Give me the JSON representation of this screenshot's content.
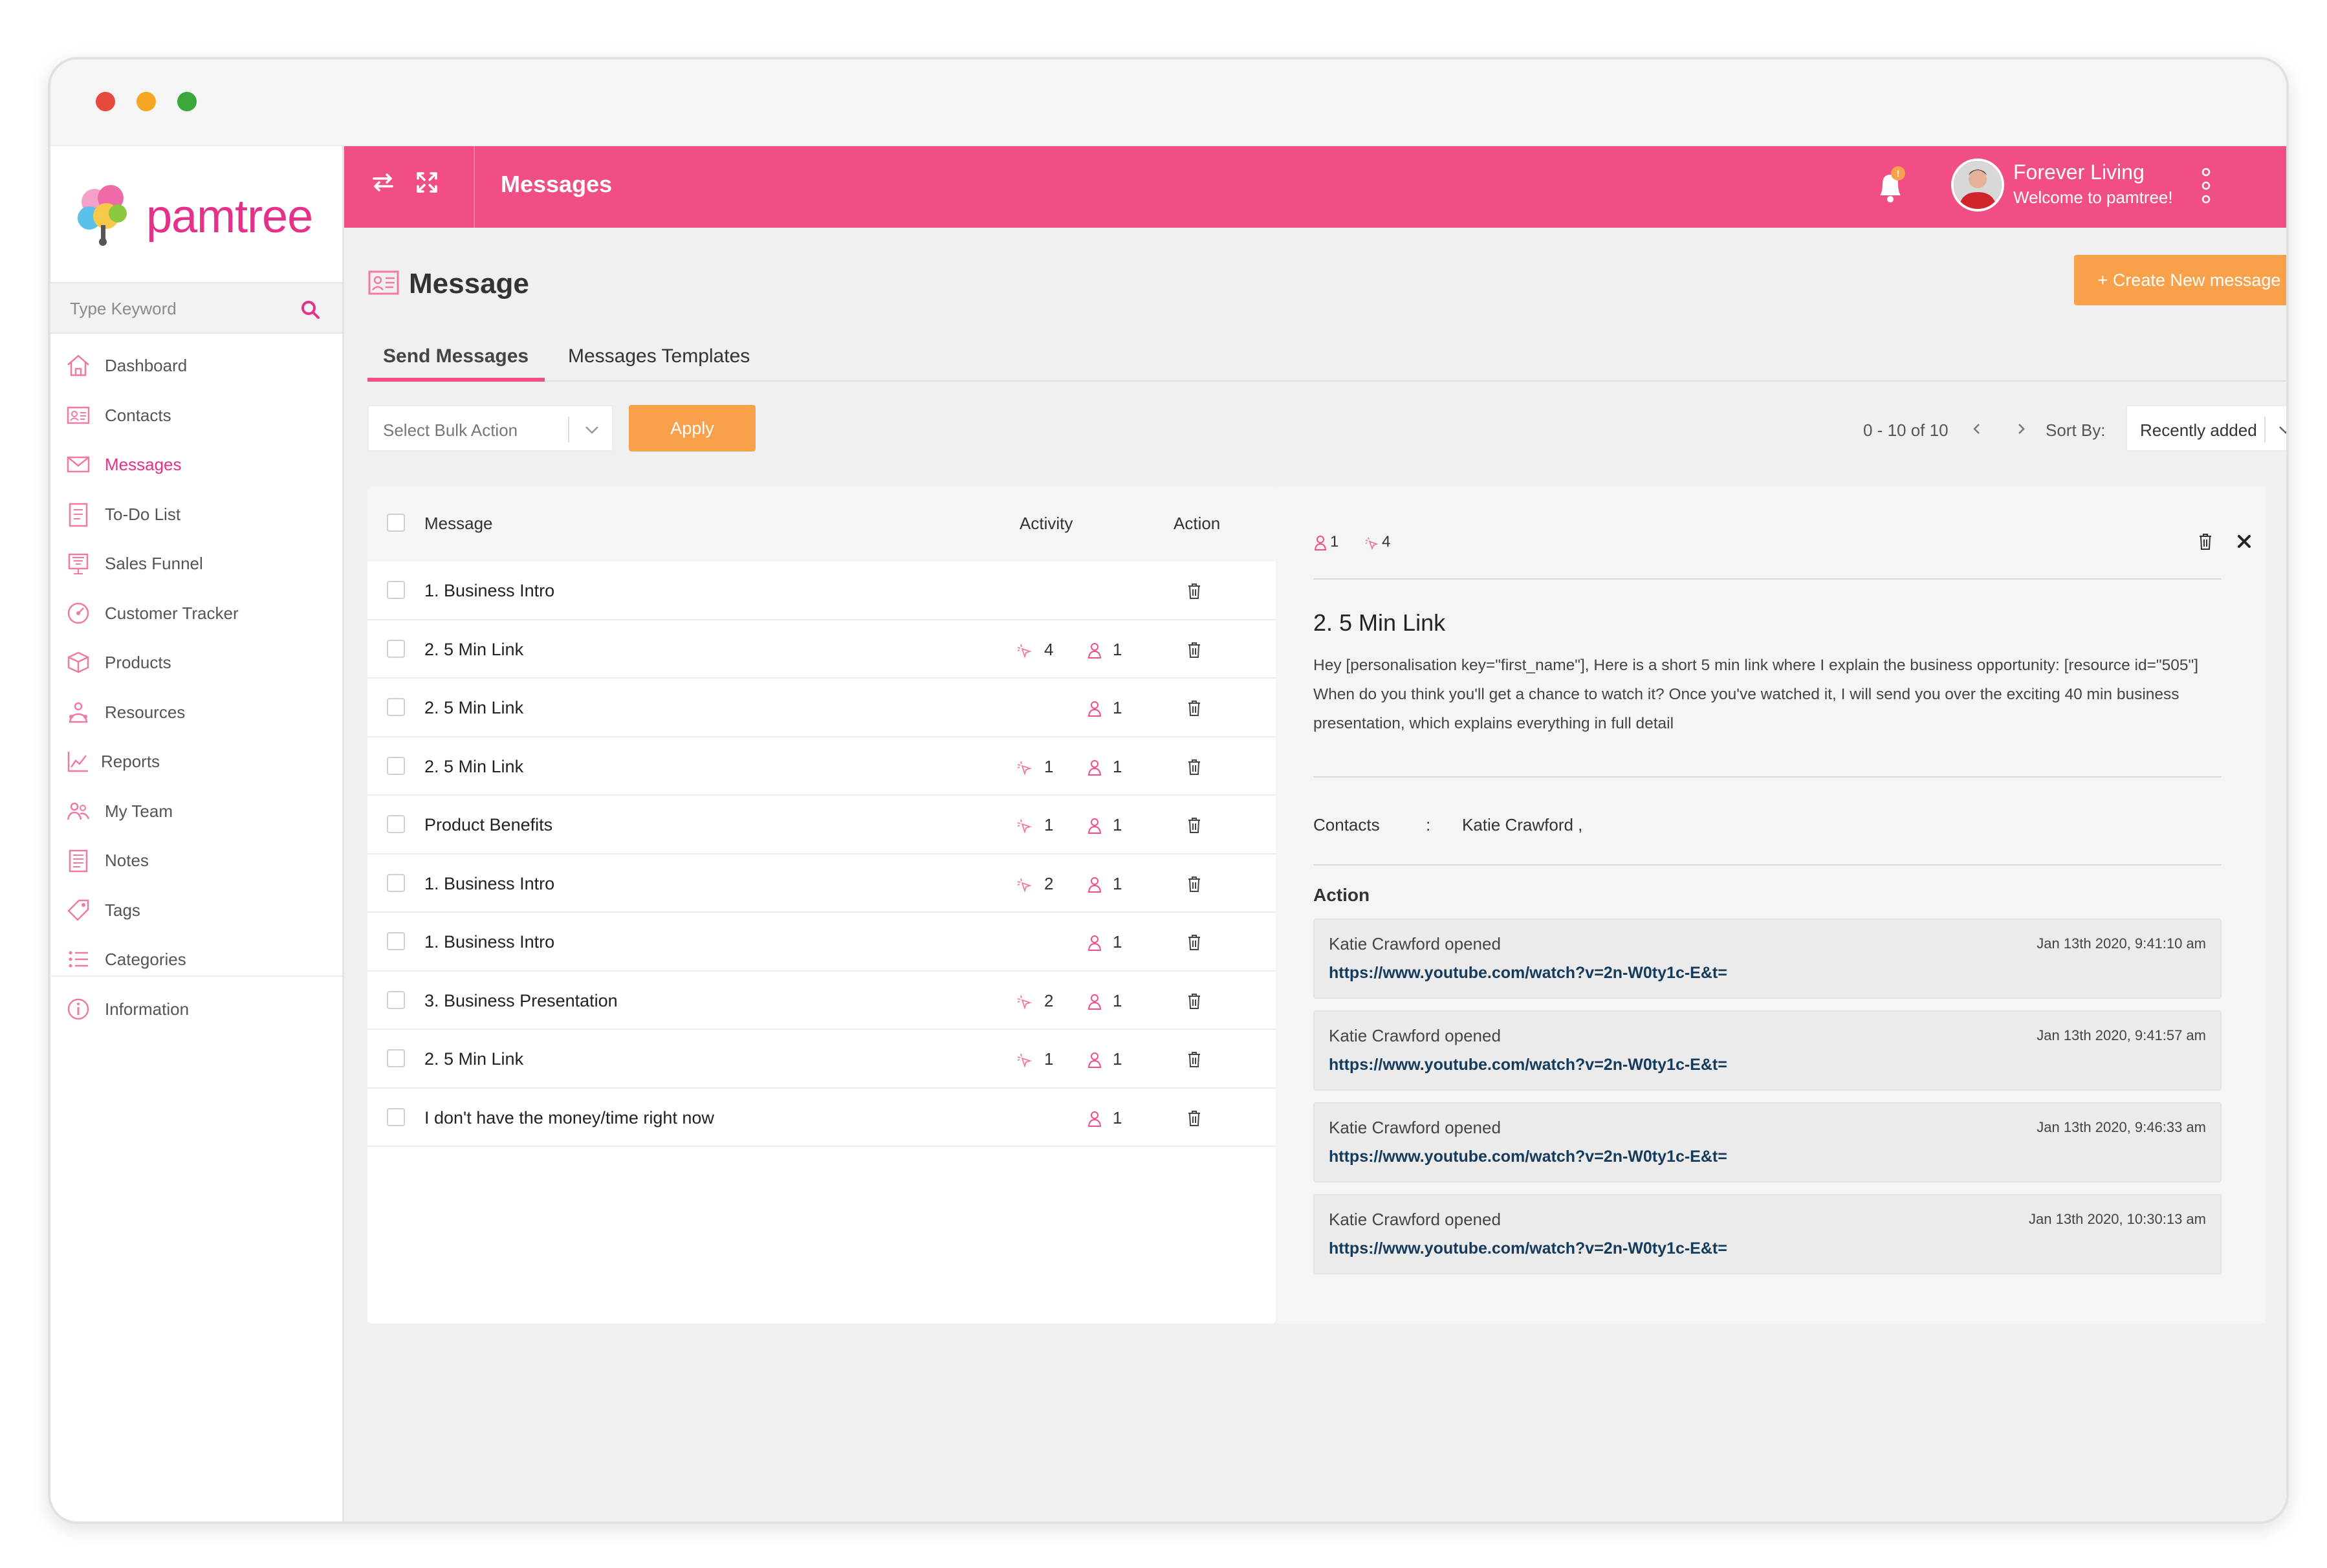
{
  "app": {
    "logo_text": "pamtree",
    "accent_color": "#f04e85",
    "orange_color": "#f9a04a"
  },
  "sidebar": {
    "search_placeholder": "Type Keyword",
    "items": [
      {
        "label": "Dashboard",
        "icon": "home-icon"
      },
      {
        "label": "Contacts",
        "icon": "contacts-card-icon"
      },
      {
        "label": "Messages",
        "icon": "envelope-icon",
        "active": true
      },
      {
        "label": "To-Do List",
        "icon": "clipboard-list-icon"
      },
      {
        "label": "Sales Funnel",
        "icon": "funnel-chart-icon"
      },
      {
        "label": "Customer Tracker",
        "icon": "tracker-gauge-icon"
      },
      {
        "label": "Products",
        "icon": "package-box-icon"
      },
      {
        "label": "Resources",
        "icon": "resources-people-icon"
      },
      {
        "label": "Reports",
        "icon": "line-chart-icon"
      },
      {
        "label": "My Team",
        "icon": "team-icon"
      },
      {
        "label": "Notes",
        "icon": "notes-icon"
      },
      {
        "label": "Tags",
        "icon": "tag-icon"
      },
      {
        "label": "Categories",
        "icon": "list-icon"
      },
      {
        "label": "Information",
        "icon": "info-circle-icon"
      }
    ]
  },
  "header": {
    "title": "Messages",
    "user_name": "Forever Living",
    "welcome": "Welcome to pamtree!",
    "notification_badge": "!"
  },
  "page": {
    "title": "Message",
    "create_button": "+ Create New message",
    "tabs": [
      "Send Messages",
      "Messages Templates"
    ],
    "bulk_action_placeholder": "Select Bulk Action",
    "apply_label": "Apply",
    "pagination": "0 - 10 of 10",
    "sort_by_label": "Sort By:",
    "sort_value": "Recently added"
  },
  "table": {
    "headers": {
      "message": "Message",
      "activity": "Activity",
      "action": "Action"
    },
    "rows": [
      {
        "message": "1. Business Intro",
        "clicks": "",
        "users": ""
      },
      {
        "message": "2. 5 Min Link",
        "clicks": "4",
        "users": "1"
      },
      {
        "message": "2. 5 Min Link",
        "clicks": "",
        "users": "1"
      },
      {
        "message": "2. 5 Min Link",
        "clicks": "1",
        "users": "1"
      },
      {
        "message": "Product Benefits",
        "clicks": "1",
        "users": "1"
      },
      {
        "message": "1. Business Intro",
        "clicks": "2",
        "users": "1"
      },
      {
        "message": "1. Business Intro",
        "clicks": "",
        "users": "1"
      },
      {
        "message": "3. Business Presentation",
        "clicks": "2",
        "users": "1"
      },
      {
        "message": "2. 5 Min Link",
        "clicks": "1",
        "users": "1"
      },
      {
        "message": "I don't have the money/time right now",
        "clicks": "",
        "users": "1"
      }
    ]
  },
  "detail": {
    "users_count": "1",
    "clicks_count": "4",
    "title": "2. 5 Min Link",
    "body": "Hey [personalisation key=\"first_name\"], Here is a short 5 min link where I explain the business opportunity: [resource id=\"505\"] When do you think you'll get a chance to watch it? Once you've watched it, I will send you over the exciting 40 min business presentation, which explains everything in full detail",
    "contacts_label": "Contacts",
    "contacts_colon": ":",
    "contacts_value": "Katie Crawford ,",
    "action_title": "Action",
    "logs": [
      {
        "who": "Katie Crawford opened",
        "when": "Jan 13th 2020, 9:41:10 am",
        "link": "https://www.youtube.com/watch?v=2n-W0ty1c-E&t="
      },
      {
        "who": "Katie Crawford opened",
        "when": "Jan 13th 2020, 9:41:57 am",
        "link": "https://www.youtube.com/watch?v=2n-W0ty1c-E&t="
      },
      {
        "who": "Katie Crawford opened",
        "when": "Jan 13th 2020, 9:46:33 am",
        "link": "https://www.youtube.com/watch?v=2n-W0ty1c-E&t="
      },
      {
        "who": "Katie Crawford opened",
        "when": "Jan 13th 2020, 10:30:13 am",
        "link": "https://www.youtube.com/watch?v=2n-W0ty1c-E&t="
      }
    ]
  }
}
